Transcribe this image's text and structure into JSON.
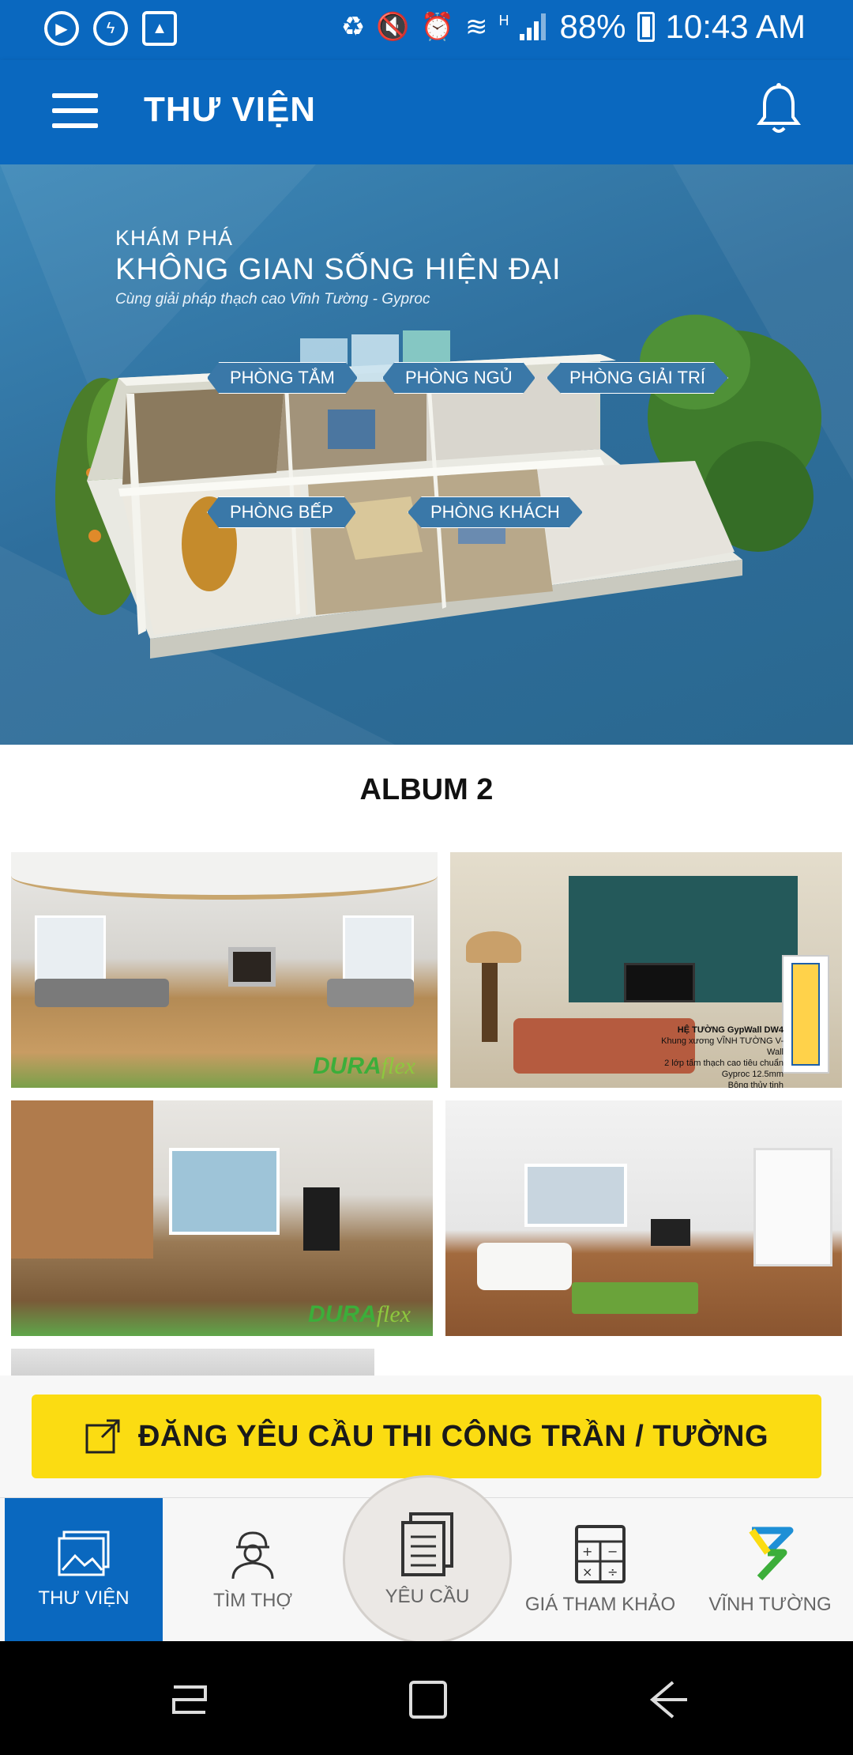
{
  "status_bar": {
    "battery": "88%",
    "time": "10:43 AM",
    "network": "H",
    "left_icons": [
      "video-call-icon",
      "messenger-icon",
      "gallery-icon"
    ],
    "right_icons": [
      "battery-saver-icon",
      "mute-icon",
      "alarm-icon",
      "wifi-icon",
      "signal-icon",
      "battery-icon"
    ]
  },
  "app_bar": {
    "title": "THƯ VIỆN",
    "menu_icon": "menu-icon",
    "bell_icon": "bell-icon"
  },
  "hero": {
    "kicker": "KHÁM PHÁ",
    "title": "KHÔNG GIAN SỐNG HIỆN ĐẠI",
    "subtitle": "Cùng giải pháp thạch cao Vĩnh Tường - Gyproc",
    "rooms": {
      "bath": "PHÒNG TẮM",
      "bed": "PHÒNG NGỦ",
      "ent": "PHÒNG GIẢI TRÍ",
      "kitchen": "PHÒNG BẾP",
      "living": "PHÒNG KHÁCH"
    }
  },
  "album": {
    "title": "ALBUM 2",
    "photos": [
      {
        "logo_a": "DURA",
        "logo_b": "flex"
      },
      {
        "caption_title": "HỆ TƯỜNG GypWall DW4",
        "caption_1": "Khung xương VĨNH TƯỜNG V-Wall",
        "caption_2": "2 lớp tấm thạch cao tiêu chuẩn Gyproc 12.5mm",
        "caption_3": "Bông thủy tinh"
      },
      {
        "logo_a": "DURA",
        "logo_b": "flex"
      },
      {}
    ]
  },
  "cta": {
    "label": "ĐĂNG YÊU CẦU THI CÔNG TRẦN / TƯỜNG",
    "icon": "external-link-icon"
  },
  "bottom_nav": {
    "library": "THƯ VIỆN",
    "find_worker": "TÌM THỢ",
    "request": "YÊU CẦU",
    "price": "GIÁ THAM KHẢO",
    "brand": "VĨNH TƯỜNG"
  },
  "colors": {
    "primary": "#0a68bf",
    "cta": "#fbdc12",
    "nav_bg": "#f7f7f7"
  }
}
